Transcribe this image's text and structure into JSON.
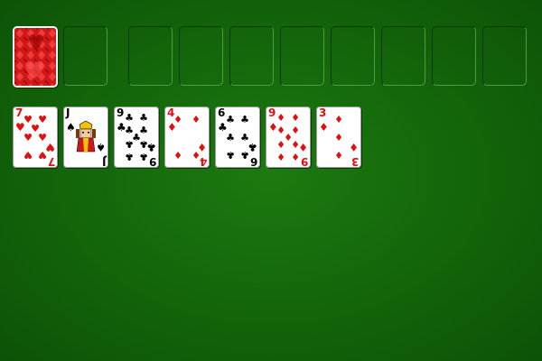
{
  "game": "Solitaire",
  "stock": {
    "face": "back",
    "back_color": "#d01818"
  },
  "empty_slots": 9,
  "tableau": [
    {
      "rank": "7",
      "suit": "hearts",
      "color": "red"
    },
    {
      "rank": "J",
      "suit": "spades",
      "color": "black"
    },
    {
      "rank": "9",
      "suit": "clubs",
      "color": "black"
    },
    {
      "rank": "4",
      "suit": "diamonds",
      "color": "red"
    },
    {
      "rank": "6",
      "suit": "clubs",
      "color": "black"
    },
    {
      "rank": "9",
      "suit": "diamonds",
      "color": "red"
    },
    {
      "rank": "3",
      "suit": "diamonds",
      "color": "red"
    }
  ],
  "colors": {
    "felt": "#156a0b",
    "red_suit": "#e01010",
    "black_suit": "#000000"
  }
}
